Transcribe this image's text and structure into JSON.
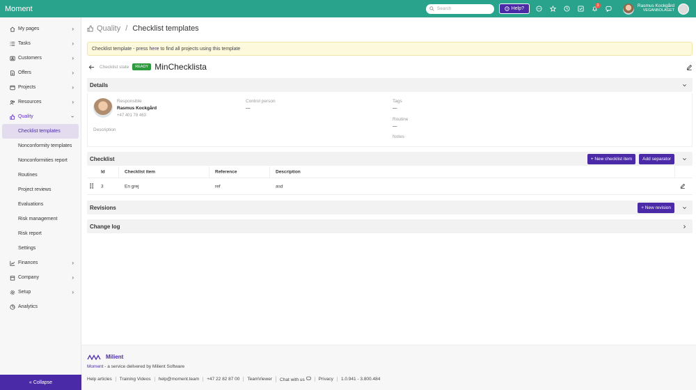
{
  "app": {
    "logo": "Moment"
  },
  "topbar": {
    "search_placeholder": "Search",
    "help_label": "Help?",
    "notification_count": "3",
    "user_name": "Rasmus Kockgård",
    "user_org": "VEGANBOLAGET"
  },
  "sidebar": {
    "items": [
      {
        "label": "My pages"
      },
      {
        "label": "Tasks"
      },
      {
        "label": "Customers"
      },
      {
        "label": "Offers"
      },
      {
        "label": "Projects"
      },
      {
        "label": "Resources"
      },
      {
        "label": "Quality"
      },
      {
        "label": "Finances"
      },
      {
        "label": "Company"
      },
      {
        "label": "Setup"
      },
      {
        "label": "Analytics"
      }
    ],
    "quality_sub": [
      {
        "label": "Checklist templates"
      },
      {
        "label": "Nonconformity templates"
      },
      {
        "label": "Nonconformities report"
      },
      {
        "label": "Routines"
      },
      {
        "label": "Project reviews"
      },
      {
        "label": "Evaluations"
      },
      {
        "label": "Risk management"
      },
      {
        "label": "Risk report"
      },
      {
        "label": "Settings"
      }
    ],
    "collapse_label": "Collapse"
  },
  "breadcrumb": {
    "parent": "Quality",
    "current": "Checklist templates"
  },
  "notice": {
    "prefix": "Checklist template - press",
    "link": "here",
    "suffix": "to find all projects using this template"
  },
  "checklist": {
    "state_label": "Checklist state",
    "state": "READY",
    "title": "MinChecklista"
  },
  "details": {
    "header": "Details",
    "responsible_label": "Responsible",
    "responsible_name": "Rasmus Kockgård",
    "responsible_phone": "+47 401 78 463",
    "control_label": "Control person",
    "control_value": "—",
    "description_label": "Description",
    "tags_label": "Tags",
    "tags_value": "—",
    "routine_label": "Routine",
    "routine_value": "—",
    "notes_label": "Notes"
  },
  "checklist_section": {
    "header": "Checklist",
    "new_item_btn": "+ New checklist item",
    "add_sep_btn": "Add separator",
    "columns": [
      "Id",
      "Checklist item",
      "Reference",
      "Description"
    ],
    "rows": [
      {
        "id": "3",
        "item": "En grej",
        "reference": "ref",
        "description": "asd"
      }
    ]
  },
  "revisions": {
    "header": "Revisions",
    "new_btn": "+ New revision"
  },
  "changelog": {
    "header": "Change log"
  },
  "footer": {
    "brand": "Milient",
    "tagline_link": "Moment",
    "tagline_rest": " - a service delivered by Milient Software",
    "links": [
      "Help articles",
      "Training Videos",
      "help@moment.team",
      "+47 22 82 87 00",
      "TeamViewer",
      "Chat with us",
      "Privacy",
      "1.0.941 - 3.800.484"
    ]
  }
}
